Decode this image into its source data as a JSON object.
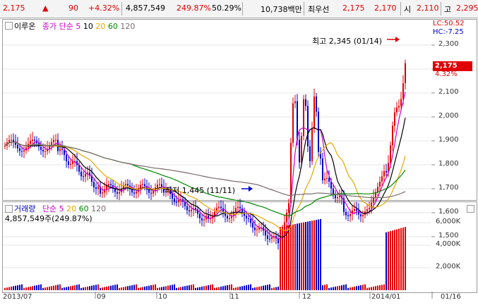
{
  "topbar": {
    "price": "2,175",
    "change_arrow": "▲",
    "change": "90",
    "change_pct": "+4.32%",
    "volume": "4,857,549",
    "volume_ratio": "249.87%",
    "turnover": "50.29%",
    "amount": "10,738백만",
    "ask_label": "최우선",
    "ask1": "2,175",
    "bid1": "2,170",
    "open_label": "시",
    "open": "2,110",
    "high_label": "고",
    "high": "2,295"
  },
  "price_pane": {
    "stock_name": "이루온",
    "ma_label": "종가 단순",
    "ma_periods": [
      "5",
      "10",
      "20",
      "60",
      "120"
    ],
    "lc": "LC:50.52",
    "hc": "HC:-7.25",
    "current_price": "2,175",
    "current_pct": "4.32%",
    "high_annotation": "최고 2,345 (01/14)",
    "low_annotation": "최저 1,445 (11/11)",
    "y_ticks": [
      "2,300",
      "2,200",
      "2,100",
      "2,000",
      "1,900",
      "1,800",
      "1,700",
      "1,600",
      "1,500"
    ]
  },
  "volume_pane": {
    "title": "거래량",
    "ma_label": "단순",
    "ma_periods": [
      "5",
      "20",
      "60",
      "120"
    ],
    "last_volume": "4,857,549주(249.87%)",
    "y_ticks": [
      "6,000K",
      "4,000K",
      "2,000K"
    ]
  },
  "x_labels": [
    "2013/07",
    "09",
    "10",
    "11",
    "12",
    "2014/01",
    "01/16"
  ],
  "colors": {
    "up": "#e00000",
    "down": "#0000cc",
    "ma5": "#cc00cc",
    "ma10": "#000000",
    "ma20": "#e6a800",
    "ma60": "#008800",
    "ma120": "#7a6a6a"
  },
  "chart_data": {
    "type": "candlestick",
    "x_range": [
      "2013/07",
      "2014/01/16"
    ],
    "price_ylim": [
      1400,
      2400
    ],
    "volume_ylim": [
      0,
      7000000
    ],
    "highest": {
      "value": 2345,
      "date": "01/14"
    },
    "lowest": {
      "value": 1445,
      "date": "11/11"
    },
    "series": [
      {
        "name": "MA5"
      },
      {
        "name": "MA10"
      },
      {
        "name": "MA20"
      },
      {
        "name": "MA60"
      },
      {
        "name": "MA120"
      }
    ]
  }
}
